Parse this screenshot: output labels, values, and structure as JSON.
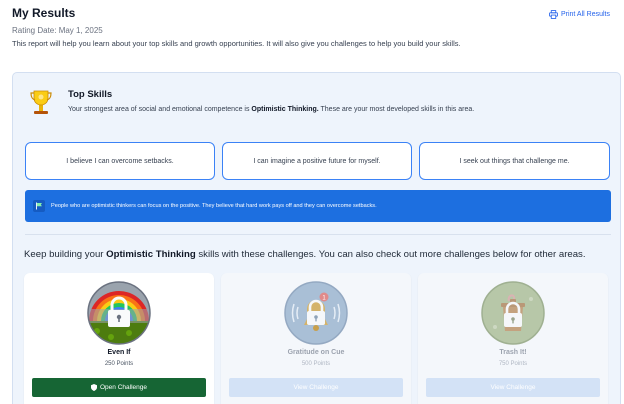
{
  "header": {
    "title": "My Results",
    "rating_date": "Rating Date: May 1, 2025",
    "description": "This report will help you learn about your top skills and growth opportunities. It will also give you challenges to help you build your skills.",
    "print_label": "Print All Results"
  },
  "top_skills": {
    "title": "Top Skills",
    "desc_prefix": "Your strongest area of social and emotional competence is ",
    "strong_area": "Optimistic Thinking.",
    "desc_suffix": " These are your most developed skills in this area.",
    "skills": [
      "I believe I can overcome setbacks.",
      "I can imagine a positive future for myself.",
      "I seek out things that challenge me."
    ],
    "banner_text": "People who are optimistic thinkers can focus on the positive. They believe that hard work pays off and they can overcome setbacks."
  },
  "challenges": {
    "intro_prefix": "Keep building your ",
    "intro_bold": "Optimistic Thinking",
    "intro_suffix": " skills with these challenges. You can also check out more challenges below for other areas.",
    "cards": [
      {
        "name": "Even If",
        "points": "250 Points",
        "button": "Open Challenge",
        "enabled": true,
        "icon": "rainbow-badge-icon"
      },
      {
        "name": "Gratitude on Cue",
        "points": "500 Points",
        "button": "View Challenge",
        "enabled": false,
        "icon": "bell-badge-icon"
      },
      {
        "name": "Trash It!",
        "points": "750 Points",
        "button": "View Challenge",
        "enabled": false,
        "icon": "trash-badge-icon"
      }
    ]
  },
  "colors": {
    "accent_blue": "#1d6fe0",
    "open_button_green": "#166534",
    "disabled_button": "#d3e2f6",
    "panel_bg": "#eef4fc"
  }
}
